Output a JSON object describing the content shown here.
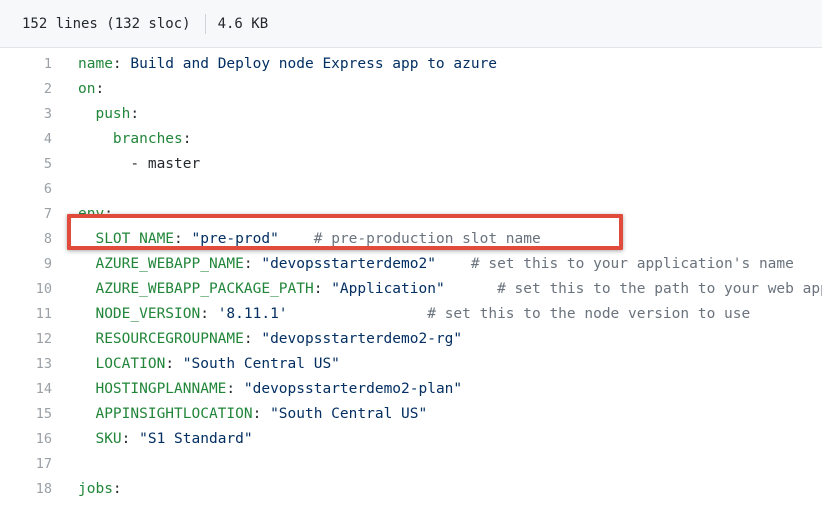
{
  "file_info": {
    "lines_sloc": "152 lines (132 sloc)",
    "size": "4.6 KB"
  },
  "code_lines": [
    {
      "num": "1",
      "indent": "",
      "key": "name",
      "sep": ": ",
      "value": "Build and Deploy node Express app to azure",
      "value_kind": "string",
      "gap": "",
      "comment": ""
    },
    {
      "num": "2",
      "indent": "",
      "key": "on",
      "sep": ":",
      "value": "",
      "value_kind": "string",
      "gap": "",
      "comment": ""
    },
    {
      "num": "3",
      "indent": "  ",
      "key": "push",
      "sep": ":",
      "value": "",
      "value_kind": "string",
      "gap": "",
      "comment": ""
    },
    {
      "num": "4",
      "indent": "    ",
      "key": "branches",
      "sep": ":",
      "value": "",
      "value_kind": "string",
      "gap": "",
      "comment": ""
    },
    {
      "num": "5",
      "indent": "      ",
      "key": "",
      "sep": "",
      "value": "- master",
      "value_kind": "plain",
      "gap": "",
      "comment": ""
    },
    {
      "num": "6",
      "indent": "",
      "key": "",
      "sep": "",
      "value": "",
      "value_kind": "plain",
      "gap": "",
      "comment": ""
    },
    {
      "num": "7",
      "indent": "",
      "key": "env",
      "sep": ":",
      "value": "",
      "value_kind": "string",
      "gap": "",
      "comment": ""
    },
    {
      "num": "8",
      "indent": "  ",
      "key": "SLOT_NAME",
      "sep": ": ",
      "value": "\"pre-prod\"",
      "value_kind": "string",
      "gap": "    ",
      "comment": "# pre-production slot name"
    },
    {
      "num": "9",
      "indent": "  ",
      "key": "AZURE_WEBAPP_NAME",
      "sep": ": ",
      "value": "\"devopsstarterdemo2\"",
      "value_kind": "string",
      "gap": "    ",
      "comment": "# set this to your application's name"
    },
    {
      "num": "10",
      "indent": "  ",
      "key": "AZURE_WEBAPP_PACKAGE_PATH",
      "sep": ": ",
      "value": "\"Application\"",
      "value_kind": "string",
      "gap": "      ",
      "comment": "# set this to the path to your web app"
    },
    {
      "num": "11",
      "indent": "  ",
      "key": "NODE_VERSION",
      "sep": ": ",
      "value": "'8.11.1'",
      "value_kind": "string",
      "gap": "                ",
      "comment": "# set this to the node version to use"
    },
    {
      "num": "12",
      "indent": "  ",
      "key": "RESOURCEGROUPNAME",
      "sep": ": ",
      "value": "\"devopsstarterdemo2-rg\"",
      "value_kind": "string",
      "gap": "",
      "comment": ""
    },
    {
      "num": "13",
      "indent": "  ",
      "key": "LOCATION",
      "sep": ": ",
      "value": "\"South Central US\"",
      "value_kind": "string",
      "gap": "",
      "comment": ""
    },
    {
      "num": "14",
      "indent": "  ",
      "key": "HOSTINGPLANNAME",
      "sep": ": ",
      "value": "\"devopsstarterdemo2-plan\"",
      "value_kind": "string",
      "gap": "",
      "comment": ""
    },
    {
      "num": "15",
      "indent": "  ",
      "key": "APPINSIGHTLOCATION",
      "sep": ": ",
      "value": "\"South Central US\"",
      "value_kind": "string",
      "gap": "",
      "comment": ""
    },
    {
      "num": "16",
      "indent": "  ",
      "key": "SKU",
      "sep": ": ",
      "value": "\"S1 Standard\"",
      "value_kind": "string",
      "gap": "",
      "comment": ""
    },
    {
      "num": "17",
      "indent": "",
      "key": "",
      "sep": "",
      "value": "",
      "value_kind": "plain",
      "gap": "",
      "comment": ""
    },
    {
      "num": "18",
      "indent": "",
      "key": "jobs",
      "sep": ":",
      "value": "",
      "value_kind": "string",
      "gap": "",
      "comment": ""
    }
  ],
  "highlight": {
    "line": "8",
    "color": "#e04b3c"
  },
  "colors": {
    "key": "#22863a",
    "string": "#032f62",
    "comment": "#6a737d",
    "line_number": "#9aa0a6",
    "header_bg": "#f6f8fa"
  }
}
